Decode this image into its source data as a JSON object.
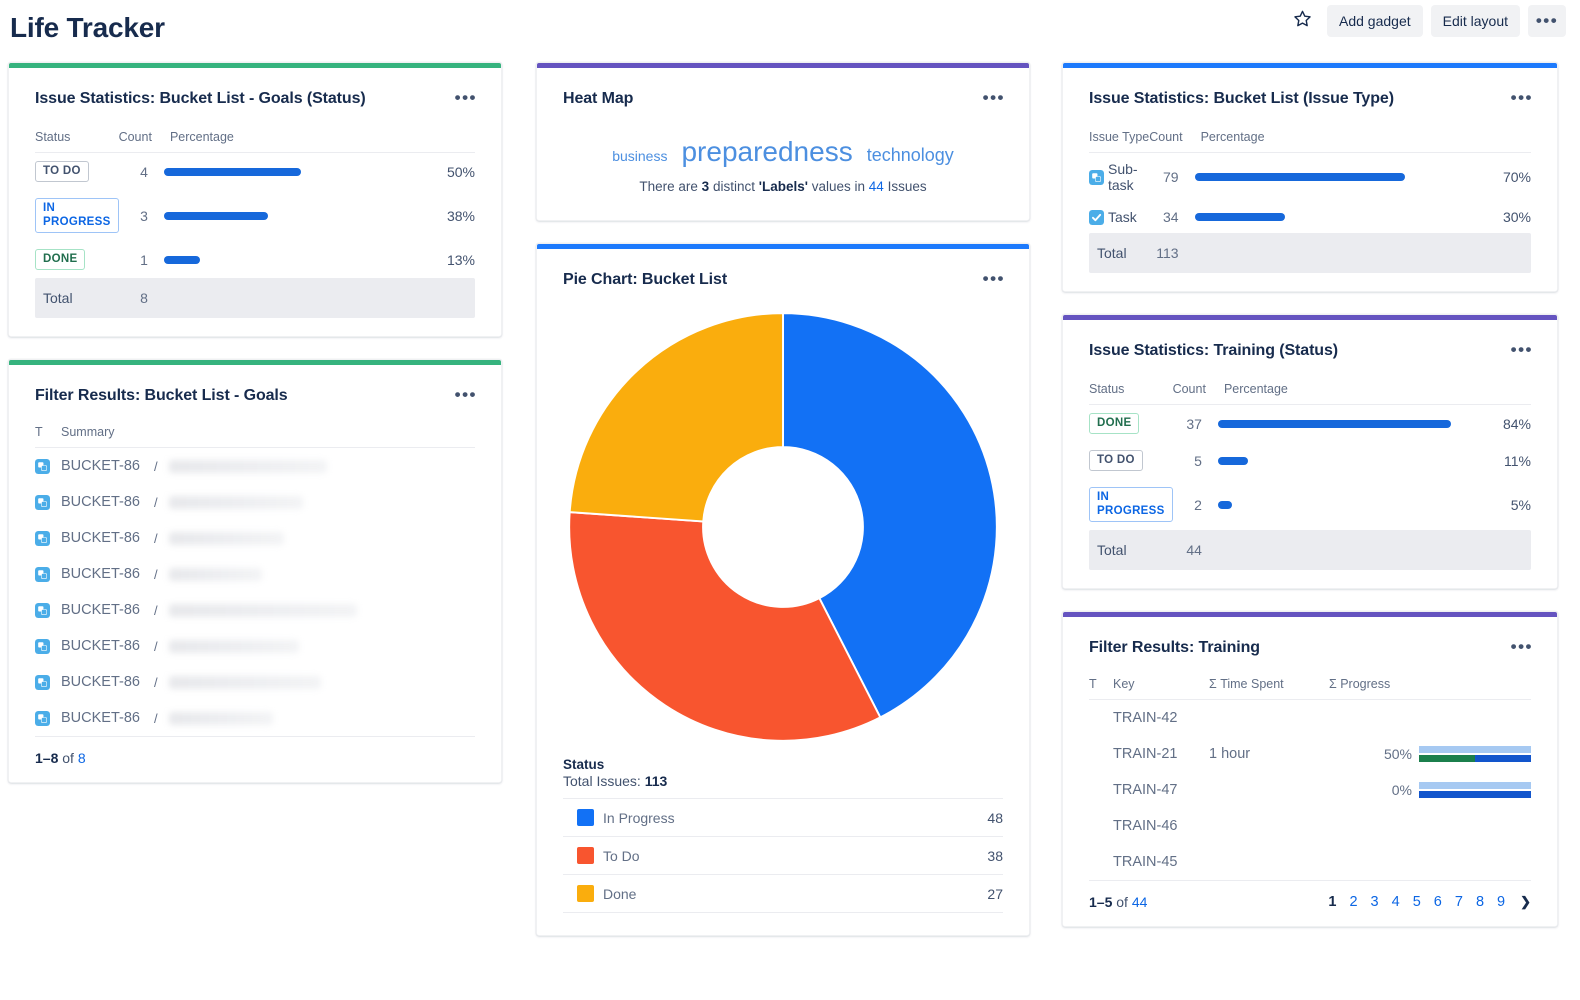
{
  "header": {
    "title": "Life Tracker",
    "star_icon": "star-icon",
    "add_gadget_label": "Add gadget",
    "edit_layout_label": "Edit layout",
    "more_icon": "ellipsis-icon"
  },
  "colors": {
    "green": "#36B37E",
    "purple": "#6554C0",
    "blue": "#1D7AFC",
    "bar_blue": "#1668DB",
    "pie_in_progress": "#1271F5",
    "pie_to_do": "#F8552F",
    "pie_done": "#FAAD0D",
    "link": "#0C66E4"
  },
  "gadgets": {
    "issue_stats_goals": {
      "accent": "#36B37E",
      "title": "Issue Statistics: Bucket List - Goals (Status)",
      "columns": [
        "Status",
        "Count",
        "Percentage"
      ],
      "rows": [
        {
          "label": "TO DO",
          "style": "todo",
          "count": "4",
          "pct": "50%",
          "pct_num": 50
        },
        {
          "label": "IN PROGRESS",
          "style": "prog",
          "count": "3",
          "pct": "38%",
          "pct_num": 38
        },
        {
          "label": "DONE",
          "style": "done",
          "count": "1",
          "pct": "13%",
          "pct_num": 13
        }
      ],
      "total_label": "Total",
      "total_value": "8"
    },
    "filter_goals": {
      "accent": "#36B37E",
      "title": "Filter Results: Bucket List - Goals",
      "columns": [
        "T",
        "Summary"
      ],
      "rows": [
        {
          "icon": "subtask-icon",
          "key": "BUCKET-86",
          "summary_width": 158
        },
        {
          "icon": "subtask-icon",
          "key": "BUCKET-86",
          "summary_width": 134
        },
        {
          "icon": "subtask-icon",
          "key": "BUCKET-86",
          "summary_width": 115
        },
        {
          "icon": "subtask-icon",
          "key": "BUCKET-86",
          "summary_width": 93
        },
        {
          "icon": "subtask-icon",
          "key": "BUCKET-86",
          "summary_width": 188
        },
        {
          "icon": "subtask-icon",
          "key": "BUCKET-86",
          "summary_width": 130
        },
        {
          "icon": "subtask-icon",
          "key": "BUCKET-86",
          "summary_width": 152
        },
        {
          "icon": "subtask-icon",
          "key": "BUCKET-86",
          "summary_width": 104
        }
      ],
      "footer_range": "1–8",
      "footer_of": "of",
      "footer_total": "8"
    },
    "heat_map": {
      "accent": "#6554C0",
      "title": "Heat Map",
      "words": [
        {
          "text": "business",
          "size": "sm"
        },
        {
          "text": "preparedness",
          "size": "lg"
        },
        {
          "text": "technology",
          "size": "md"
        }
      ],
      "note_pre": "There are",
      "note_count": "3",
      "note_mid": "distinct",
      "note_field": "'Labels'",
      "note_mid2": "values in",
      "note_issues": "44",
      "note_post": "Issues"
    },
    "pie_chart": {
      "accent": "#1D7AFC",
      "title": "Pie Chart: Bucket List",
      "legend_title": "Status",
      "total_label": "Total Issues:",
      "total_value": "113",
      "legend": [
        {
          "name": "In Progress",
          "value": "48",
          "color": "#1271F5"
        },
        {
          "name": "To Do",
          "value": "38",
          "color": "#F8552F"
        },
        {
          "name": "Done",
          "value": "27",
          "color": "#FAAD0D"
        }
      ]
    },
    "issue_stats_type": {
      "accent": "#1D7AFC",
      "title": "Issue Statistics: Bucket List (Issue Type)",
      "columns": [
        "Issue Type",
        "Count",
        "Percentage"
      ],
      "rows": [
        {
          "icon": "subtask-icon",
          "label": "Sub-task",
          "count": "79",
          "pct": "70%",
          "pct_num": 70
        },
        {
          "icon": "task-icon",
          "label": "Task",
          "count": "34",
          "pct": "30%",
          "pct_num": 30
        }
      ],
      "total_label": "Total",
      "total_value": "113"
    },
    "issue_stats_training": {
      "accent": "#6554C0",
      "title": "Issue Statistics: Training (Status)",
      "columns": [
        "Status",
        "Count",
        "Percentage"
      ],
      "rows": [
        {
          "label": "DONE",
          "style": "done",
          "count": "37",
          "pct": "84%",
          "pct_num": 84
        },
        {
          "label": "TO DO",
          "style": "todo",
          "count": "5",
          "pct": "11%",
          "pct_num": 11
        },
        {
          "label": "IN PROGRESS",
          "style": "prog",
          "count": "2",
          "pct": "5%",
          "pct_num": 5
        }
      ],
      "total_label": "Total",
      "total_value": "44"
    },
    "filter_training": {
      "accent": "#6554C0",
      "title": "Filter Results: Training",
      "columns": [
        "T",
        "Key",
        "Σ Time Spent",
        "Σ Progress"
      ],
      "rows": [
        {
          "icon": "task-icon",
          "key": "TRAIN-42",
          "time_spent": "",
          "progress_pct": "",
          "green": 0,
          "blue": 0
        },
        {
          "icon": "task-icon",
          "key": "TRAIN-21",
          "time_spent": "1 hour",
          "progress_pct": "50%",
          "green": 50,
          "blue": 50
        },
        {
          "icon": "task-icon",
          "key": "TRAIN-47",
          "time_spent": "",
          "progress_pct": "0%",
          "green": 0,
          "blue": 100
        },
        {
          "icon": "task-icon",
          "key": "TRAIN-46",
          "time_spent": "",
          "progress_pct": "",
          "green": 0,
          "blue": 0
        },
        {
          "icon": "task-icon",
          "key": "TRAIN-45",
          "time_spent": "",
          "progress_pct": "",
          "green": 0,
          "blue": 0
        }
      ],
      "footer_range": "1–5",
      "footer_of": "of",
      "footer_total": "44",
      "pages": [
        "1",
        "2",
        "3",
        "4",
        "5",
        "6",
        "7",
        "8",
        "9"
      ],
      "current_page": "1",
      "next_icon": "chevron-right-icon"
    }
  },
  "chart_data": {
    "type": "pie",
    "title": "Pie Chart: Bucket List",
    "subtitle": "Status",
    "categories": [
      "In Progress",
      "To Do",
      "Done"
    ],
    "values": [
      48,
      38,
      27
    ],
    "colors": [
      "#1271F5",
      "#F8552F",
      "#FAAD0D"
    ],
    "total": 113,
    "donut": true,
    "legend_position": "bottom"
  }
}
